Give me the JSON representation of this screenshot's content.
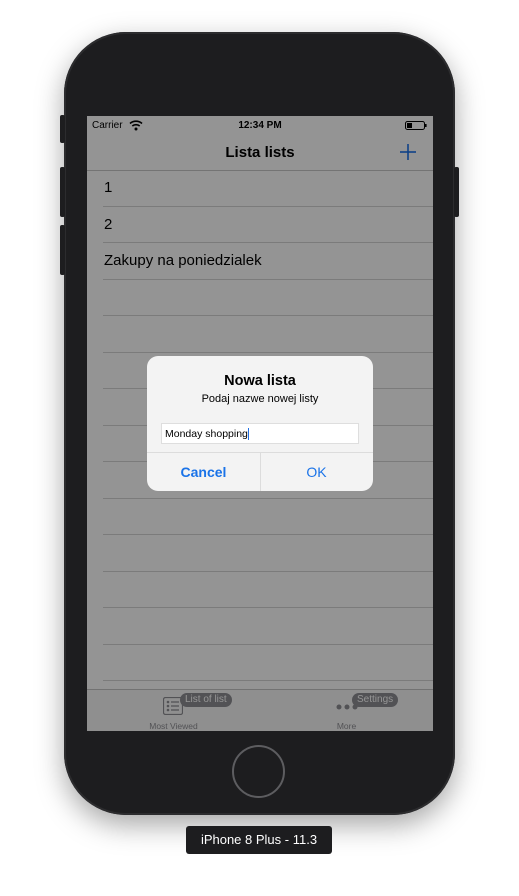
{
  "status_bar": {
    "carrier": "Carrier",
    "time": "12:34 PM"
  },
  "nav": {
    "title": "Lista lists",
    "add_icon": "plus-icon"
  },
  "list_items": [
    {
      "label": "1"
    },
    {
      "label": "2"
    },
    {
      "label": "Zakupy na poniedzialek"
    },
    {
      "label": ""
    },
    {
      "label": ""
    },
    {
      "label": ""
    },
    {
      "label": ""
    },
    {
      "label": ""
    },
    {
      "label": ""
    },
    {
      "label": ""
    },
    {
      "label": ""
    },
    {
      "label": ""
    },
    {
      "label": ""
    },
    {
      "label": ""
    }
  ],
  "tabs": [
    {
      "badge": "List of list",
      "caption": "Most Viewed",
      "icon": "list-icon"
    },
    {
      "badge": "Settings",
      "caption": "More",
      "icon": "more-icon"
    }
  ],
  "alert": {
    "title": "Nowa lista",
    "message": "Podaj nazwe nowej listy",
    "input_value": "Monday shopping",
    "cancel_label": "Cancel",
    "ok_label": "OK"
  },
  "device": {
    "label": "iPhone 8 Plus - 11.3"
  },
  "colors": {
    "accent": "#1a73e8",
    "dim": "rgba(0,0,0,0.42)",
    "bezel": "#1d1d1f"
  }
}
